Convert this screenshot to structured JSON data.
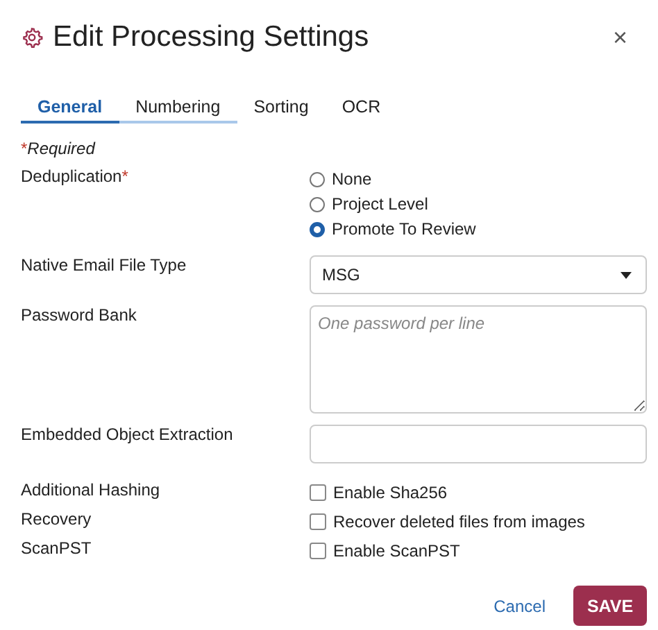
{
  "window": {
    "title": "Edit Processing Settings",
    "close": "×"
  },
  "tabs": [
    {
      "label": "General",
      "selected": true,
      "hovered": false
    },
    {
      "label": "Numbering",
      "selected": false,
      "hovered": true
    },
    {
      "label": "Sorting",
      "selected": false,
      "hovered": false
    },
    {
      "label": "OCR",
      "selected": false,
      "hovered": false
    }
  ],
  "required_note": {
    "mark": "*",
    "text": "Required"
  },
  "fields": [
    {
      "kind": "radio",
      "label": "Deduplication",
      "required": true,
      "options": [
        {
          "label": "None",
          "selected": false
        },
        {
          "label": "Project Level",
          "selected": false
        },
        {
          "label": "Promote To Review",
          "selected": true
        }
      ]
    },
    {
      "kind": "select",
      "label": "Native Email File Type",
      "required": false,
      "value": "MSG"
    },
    {
      "kind": "textarea",
      "label": "Password Bank",
      "required": false,
      "placeholder": "One password per line"
    },
    {
      "kind": "text",
      "label": "Embedded Object Extraction",
      "required": false
    },
    {
      "kind": "checkbox",
      "label": "Additional Hashing",
      "required": false,
      "option": "Enable Sha256",
      "checked": false
    },
    {
      "kind": "checkbox",
      "label": "Recovery",
      "required": false,
      "option": "Recover deleted files from images",
      "checked": false
    },
    {
      "kind": "checkbox",
      "label": "ScanPST",
      "required": false,
      "option": "Enable ScanPST",
      "checked": false
    }
  ],
  "buttons": {
    "cancel": "Cancel",
    "save": "SAVE"
  }
}
